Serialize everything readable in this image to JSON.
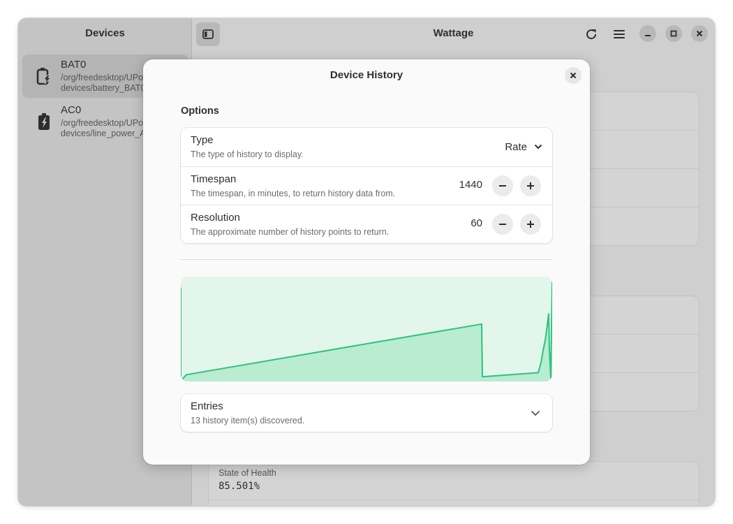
{
  "sidebar": {
    "title": "Devices",
    "devices": [
      {
        "name": "BAT0",
        "path_line1": "/org/freedesktop/UPower/",
        "path_line2": "devices/battery_BAT0",
        "icon": "battery-charging-icon",
        "selected": true
      },
      {
        "name": "AC0",
        "path_line1": "/org/freedesktop/UPower/",
        "path_line2": "devices/line_power_AC0",
        "icon": "ac-power-icon",
        "selected": false
      }
    ]
  },
  "header": {
    "title": "Wattage",
    "icons": [
      "sidebar-toggle-icon",
      "refresh-icon",
      "menu-icon",
      "minimize-icon",
      "maximize-icon",
      "close-icon"
    ]
  },
  "background": {
    "state_of_health_label": "State of Health",
    "state_of_health_value": "85.501%"
  },
  "dialog": {
    "title": "Device History",
    "options_title": "Options",
    "type": {
      "title": "Type",
      "subtitle": "The type of history to display.",
      "selected": "Rate"
    },
    "timespan": {
      "title": "Timespan",
      "subtitle": "The timespan, in minutes, to return history data from.",
      "value": "1440"
    },
    "resolution": {
      "title": "Resolution",
      "subtitle": "The approximate number of history points to return.",
      "value": "60"
    },
    "entries": {
      "title": "Entries",
      "subtitle": "13 history item(s) discovered."
    }
  },
  "chart_data": {
    "type": "area",
    "x": [
      0,
      1,
      2,
      3,
      4,
      5,
      6,
      7,
      8,
      9,
      10,
      11,
      12
    ],
    "values": [
      0.0,
      0.06,
      0.56,
      0.04,
      0.08,
      0.18,
      0.3,
      0.4,
      0.5,
      0.66,
      0.3,
      0.03,
      0.98
    ],
    "colors": {
      "line": "#2ec27e",
      "fill": "#b9ecd0",
      "background": "#e3f6ec"
    }
  }
}
